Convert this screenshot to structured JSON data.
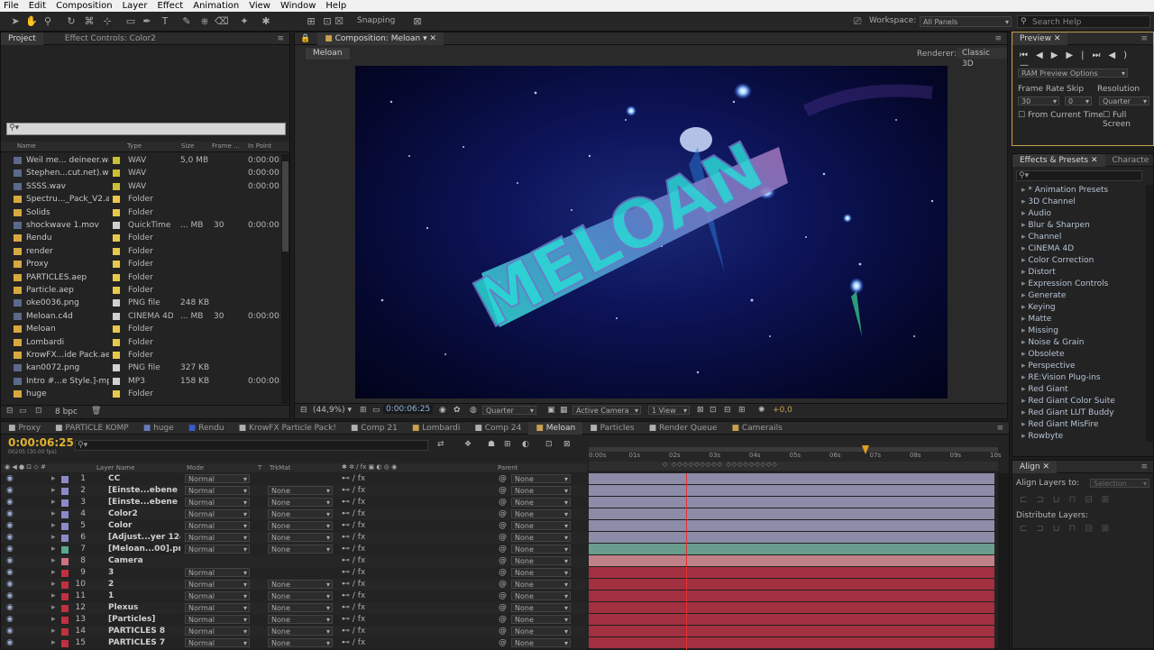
{
  "menu": [
    "File",
    "Edit",
    "Composition",
    "Layer",
    "Effect",
    "Animation",
    "View",
    "Window",
    "Help"
  ],
  "toolbar": {
    "snapping_label": "Snapping",
    "workspace_label": "Workspace:",
    "workspace_value": "All Panels",
    "search_placeholder": "Search Help"
  },
  "project_panel": {
    "tabs": [
      "Project",
      "Effect Controls: Color2"
    ],
    "search_placeholder": "",
    "columns": [
      "Name",
      "Type",
      "Size",
      "Frame ...",
      "In Point"
    ],
    "items": [
      {
        "name": "Weil me... deineer.wav",
        "type": "WAV",
        "size": "5,0 MB",
        "frame": "",
        "in": "0:00:00:0",
        "color": "#c9c034"
      },
      {
        "name": "Stephen...cut.net).wav",
        "type": "WAV",
        "size": "",
        "frame": "",
        "in": "0:00:00:0",
        "color": "#c9c034"
      },
      {
        "name": "SSSS.wav",
        "type": "WAV",
        "size": "",
        "frame": "",
        "in": "0:00:00:0",
        "color": "#c9c034"
      },
      {
        "name": "Spectru..._Pack_V2.aep",
        "type": "Folder",
        "size": "",
        "frame": "",
        "in": "",
        "color": "#e8c84a"
      },
      {
        "name": "Solids",
        "type": "Folder",
        "size": "",
        "frame": "",
        "in": "",
        "color": "#e8c84a"
      },
      {
        "name": "shockwave 1.mov",
        "type": "QuickTime",
        "size": "... MB",
        "frame": "30",
        "in": "0:00:00:0",
        "color": "#d0d0d0"
      },
      {
        "name": "Rendu",
        "type": "Folder",
        "size": "",
        "frame": "",
        "in": "",
        "color": "#e8c84a"
      },
      {
        "name": "render",
        "type": "Folder",
        "size": "",
        "frame": "",
        "in": "",
        "color": "#e8c84a"
      },
      {
        "name": "Proxy",
        "type": "Folder",
        "size": "",
        "frame": "",
        "in": "",
        "color": "#e8c84a"
      },
      {
        "name": "PARTICLES.aep",
        "type": "Folder",
        "size": "",
        "frame": "",
        "in": "",
        "color": "#e8c84a"
      },
      {
        "name": "Particle.aep",
        "type": "Folder",
        "size": "",
        "frame": "",
        "in": "",
        "color": "#e8c84a"
      },
      {
        "name": "oke0036.png",
        "type": "PNG file",
        "size": "248 KB",
        "frame": "",
        "in": "",
        "color": "#d0d0d0"
      },
      {
        "name": "Meloan.c4d",
        "type": "CINEMA 4D",
        "size": "... MB",
        "frame": "30",
        "in": "0:00:00:0",
        "color": "#d0d0d0"
      },
      {
        "name": "Meloan",
        "type": "Folder",
        "size": "",
        "frame": "",
        "in": "",
        "color": "#e8c84a"
      },
      {
        "name": "Lombardi",
        "type": "Folder",
        "size": "",
        "frame": "",
        "in": "",
        "color": "#e8c84a"
      },
      {
        "name": "KrowFX...ide Pack.aep",
        "type": "Folder",
        "size": "",
        "frame": "",
        "in": "",
        "color": "#e8c84a"
      },
      {
        "name": "kan0072.png",
        "type": "PNG file",
        "size": "327 KB",
        "frame": "",
        "in": "",
        "color": "#d0d0d0"
      },
      {
        "name": "Intro #...e Style.]-mp3",
        "type": "MP3",
        "size": "158 KB",
        "frame": "",
        "in": "0:00:00:0",
        "color": "#d0d0d0"
      },
      {
        "name": "huge",
        "type": "Folder",
        "size": "",
        "frame": "",
        "in": "",
        "color": "#e8c84a"
      }
    ],
    "bpc": "8 bpc"
  },
  "comp_panel": {
    "tab": "Composition: Meloan",
    "breadcrumb": "Meloan",
    "renderer_label": "Renderer:",
    "renderer_value": "Classic 3D",
    "title_overlay": "MELOAN",
    "zoom": "(44,9%)",
    "timecode": "0:00:06:25",
    "resolution": "Quarter",
    "camera": "Active Camera",
    "view": "1 View",
    "exposure": "+0,0"
  },
  "preview_panel": {
    "tab": "Preview",
    "ram_options": "RAM Preview Options",
    "frame_rate_label": "Frame Rate",
    "skip_label": "Skip",
    "resolution_label": "Resolution",
    "frame_rate": "30",
    "skip": "0",
    "resolution": "Quarter",
    "from_current": "From Current Time",
    "full_screen": "Full Screen"
  },
  "effects_panel": {
    "tabs": [
      "Effects & Presets",
      "Characte"
    ],
    "items": [
      "* Animation Presets",
      "3D Channel",
      "Audio",
      "Blur & Sharpen",
      "Channel",
      "CINEMA 4D",
      "Color Correction",
      "Distort",
      "Expression Controls",
      "Generate",
      "Keying",
      "Matte",
      "Missing",
      "Noise & Grain",
      "Obsolete",
      "Perspective",
      "RE:Vision Plug-ins",
      "Red Giant",
      "Red Giant Color Suite",
      "Red Giant LUT Buddy",
      "Red Giant MisFire",
      "Rowbyte"
    ]
  },
  "align_panel": {
    "tab": "Align",
    "align_to_label": "Align Layers to:",
    "align_to_value": "Selection",
    "distribute_label": "Distribute Layers:"
  },
  "timeline": {
    "tabs": [
      {
        "label": "Proxy",
        "color": "#b0b0b0"
      },
      {
        "label": "PARTICLE KOMP",
        "color": "#b0b0b0"
      },
      {
        "label": "huge",
        "color": "#6a7ab8"
      },
      {
        "label": "Rendu",
        "color": "#3a5ac8"
      },
      {
        "label": "KrowFX Particle Pack!",
        "color": "#b0b0b0"
      },
      {
        "label": "Comp 21",
        "color": "#b0b0b0"
      },
      {
        "label": "Lombardi",
        "color": "#c8a050"
      },
      {
        "label": "Comp 24",
        "color": "#b0b0b0"
      },
      {
        "label": "Meloan",
        "color": "#c8a050"
      },
      {
        "label": "Particles",
        "color": "#b0b0b0"
      },
      {
        "label": "Render Queue",
        "color": "#b0b0b0"
      },
      {
        "label": "Camerails",
        "color": "#c8a050"
      }
    ],
    "timecode": "0:00:06:25",
    "timecode_sub": "00205 (30.00 fps)",
    "columns": {
      "layer_name": "Layer Name",
      "mode": "Mode",
      "t": "T",
      "trkmat": "TrkMat",
      "parent": "Parent"
    },
    "ruler": [
      "0:00s",
      "01s",
      "02s",
      "03s",
      "04s",
      "05s",
      "06s",
      "07s",
      "08s",
      "09s",
      "10s"
    ],
    "layers": [
      {
        "num": "1",
        "name": "CC",
        "mode": "Normal",
        "trkmat": "",
        "parent": "None",
        "color": "#8a8ac8",
        "bar": "#8c8ca8"
      },
      {
        "num": "2",
        "name": "[Einste...ebene 3]",
        "mode": "Normal",
        "trkmat": "None",
        "parent": "None",
        "color": "#8a8ac8",
        "bar": "#8c8ca8"
      },
      {
        "num": "3",
        "name": "[Einste...ebene 2]",
        "mode": "Normal",
        "trkmat": "None",
        "parent": "None",
        "color": "#8a8ac8",
        "bar": "#8c8ca8"
      },
      {
        "num": "4",
        "name": "Color2",
        "mode": "Normal",
        "trkmat": "None",
        "parent": "None",
        "color": "#8a8ac8",
        "bar": "#8c8ca8"
      },
      {
        "num": "5",
        "name": "Color",
        "mode": "Normal",
        "trkmat": "None",
        "parent": "None",
        "color": "#8a8ac8",
        "bar": "#8c8ca8"
      },
      {
        "num": "6",
        "name": "[Adjust...yer 124]",
        "mode": "Normal",
        "trkmat": "None",
        "parent": "None",
        "color": "#8a8ac8",
        "bar": "#8c8ca8"
      },
      {
        "num": "7",
        "name": "[Meloan...00].png]",
        "mode": "Normal",
        "trkmat": "None",
        "parent": "None",
        "color": "#5aa890",
        "bar": "#6a9c8e"
      },
      {
        "num": "8",
        "name": "Camera",
        "mode": "",
        "trkmat": "",
        "parent": "None",
        "color": "#d07080",
        "bar": "#c08088"
      },
      {
        "num": "9",
        "name": "3",
        "mode": "Normal",
        "trkmat": "",
        "parent": "None",
        "color": "#c03040",
        "bar": "#a33040"
      },
      {
        "num": "10",
        "name": "2",
        "mode": "Normal",
        "trkmat": "None",
        "parent": "None",
        "color": "#c03040",
        "bar": "#a33040"
      },
      {
        "num": "11",
        "name": "1",
        "mode": "Normal",
        "trkmat": "None",
        "parent": "None",
        "color": "#c03040",
        "bar": "#a33040"
      },
      {
        "num": "12",
        "name": "Plexus",
        "mode": "Normal",
        "trkmat": "None",
        "parent": "None",
        "color": "#c03040",
        "bar": "#a33040"
      },
      {
        "num": "13",
        "name": "[Particles]",
        "mode": "Normal",
        "trkmat": "None",
        "parent": "None",
        "color": "#c03040",
        "bar": "#a33040"
      },
      {
        "num": "14",
        "name": "PARTICLES 8",
        "mode": "Normal",
        "trkmat": "None",
        "parent": "None",
        "color": "#c03040",
        "bar": "#a33040"
      },
      {
        "num": "15",
        "name": "PARTICLES 7",
        "mode": "Normal",
        "trkmat": "None",
        "parent": "None",
        "color": "#c03040",
        "bar": "#a33040"
      }
    ]
  }
}
